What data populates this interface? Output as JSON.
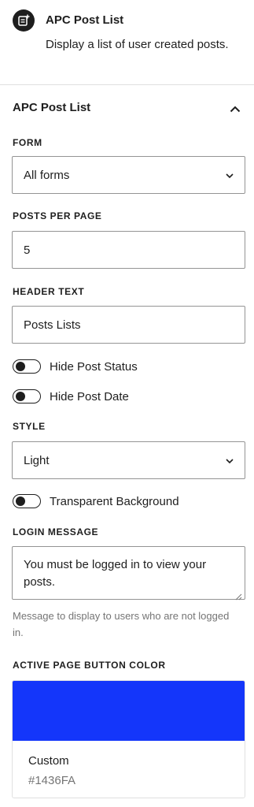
{
  "block": {
    "title": "APC Post List",
    "description": "Display a list of user created posts.",
    "icon": "post-list-icon"
  },
  "panel": {
    "title": "APC Post List",
    "toggle_icon": "chevron-up-icon"
  },
  "form": {
    "label": "FORM",
    "value": "All forms"
  },
  "posts_per_page": {
    "label": "POSTS PER PAGE",
    "value": "5"
  },
  "header_text": {
    "label": "HEADER TEXT",
    "value": "Posts Lists"
  },
  "toggles": {
    "hide_post_status": "Hide Post Status",
    "hide_post_date": "Hide Post Date",
    "transparent_background": "Transparent Background"
  },
  "style": {
    "label": "STYLE",
    "value": "Light"
  },
  "login_message": {
    "label": "LOGIN MESSAGE",
    "value": "You must be logged in to view your posts.",
    "help": "Message to display to users who are not logged in."
  },
  "active_page_button_color": {
    "label": "ACTIVE PAGE BUTTON COLOR",
    "name": "Custom",
    "hex": "#1436FA",
    "swatch_color": "#1436FA"
  }
}
